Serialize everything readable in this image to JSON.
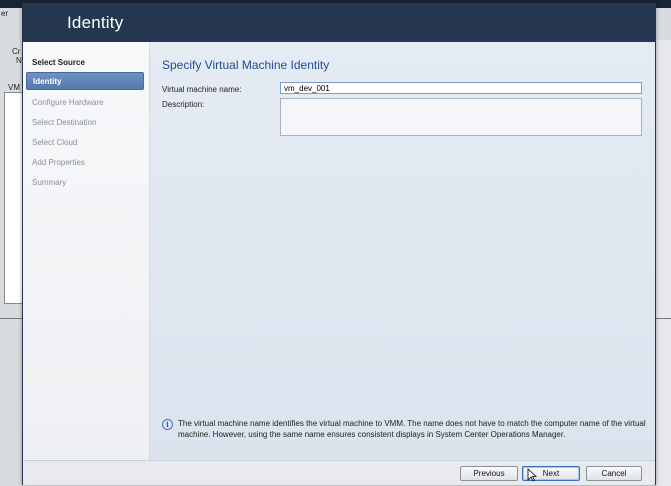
{
  "background": {
    "fragment_1": "er",
    "fragment_2": "Cr",
    "fragment_3": "N",
    "fragment_4": "VM"
  },
  "wizard": {
    "title": "Identity",
    "nav_items": [
      {
        "label": "Select Source",
        "state": "done"
      },
      {
        "label": "Identity",
        "state": "active"
      },
      {
        "label": "Configure Hardware",
        "state": "pending"
      },
      {
        "label": "Select Destination",
        "state": "pending"
      },
      {
        "label": "Select Cloud",
        "state": "pending"
      },
      {
        "label": "Add Properties",
        "state": "pending"
      },
      {
        "label": "Summary",
        "state": "pending"
      }
    ],
    "content": {
      "heading": "Specify Virtual Machine Identity",
      "vm_name_label": "Virtual machine name:",
      "vm_name_value": "vm_dev_001",
      "description_label": "Description:",
      "description_value": "",
      "info_text": "The virtual machine name identifies the virtual machine to VMM. The name does not have to match the computer name of the virtual machine. However, using the same name ensures consistent displays in System Center Operations Manager."
    },
    "buttons": {
      "previous": "Previous",
      "next": "Next",
      "cancel": "Cancel"
    }
  },
  "colors": {
    "header": "#253650",
    "active_nav": "#5a7fb3",
    "heading": "#1f4f8f",
    "content_bg": "#e0e7f0"
  }
}
